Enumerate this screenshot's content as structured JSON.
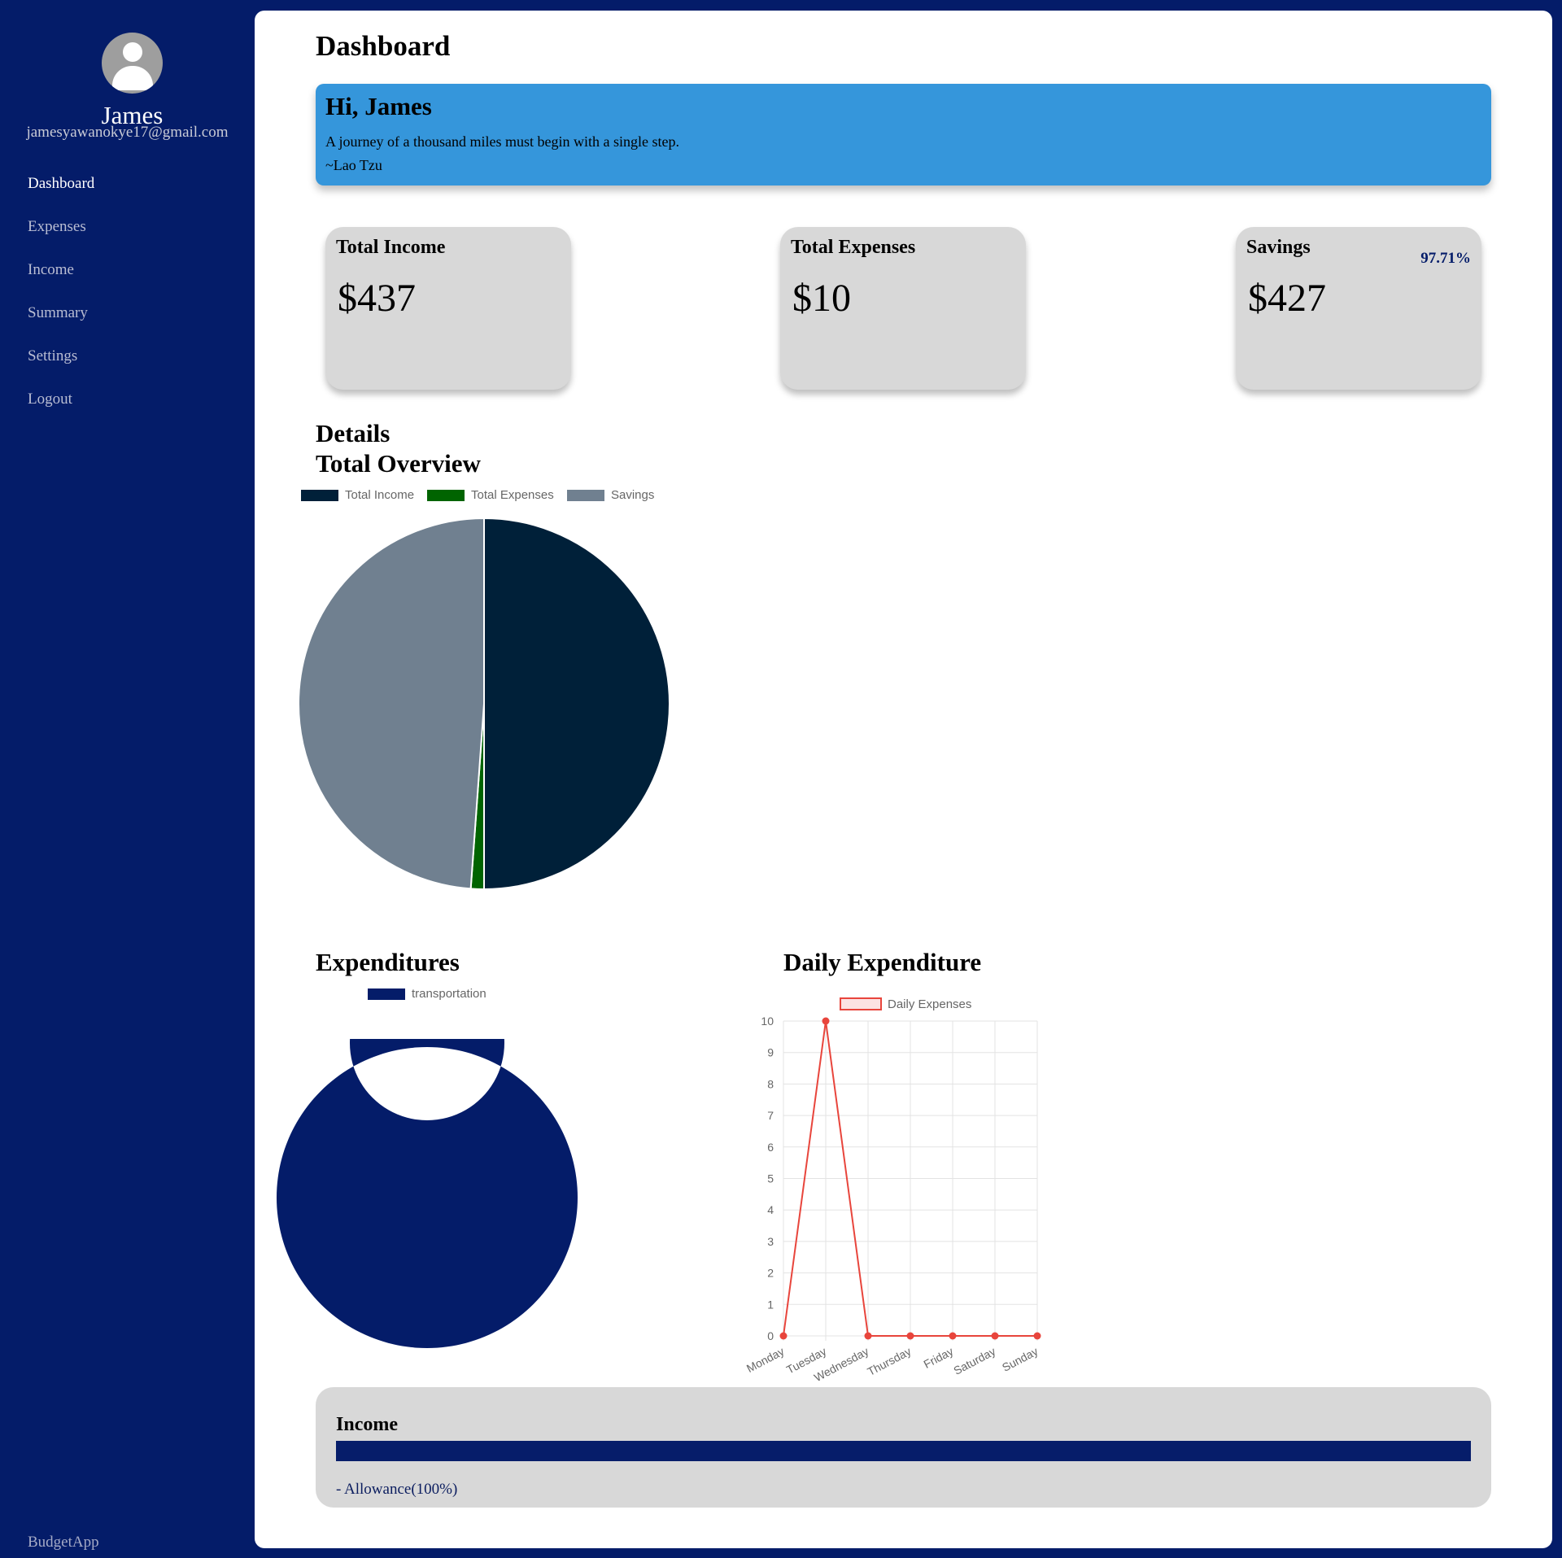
{
  "sidebar": {
    "user_name": "James",
    "user_email": "jamesyawanokye17@gmail.com",
    "nav": [
      "Dashboard",
      "Expenses",
      "Income",
      "Summary",
      "Settings",
      "Logout"
    ],
    "active_nav": "Dashboard",
    "brand": "BudgetApp"
  },
  "header": {
    "title": "Dashboard"
  },
  "banner": {
    "greeting": "Hi, James",
    "quote": "A journey of a thousand miles must begin with a single step.",
    "author": "~Lao Tzu",
    "color": "#3596db"
  },
  "stats": [
    {
      "label": "Total Income",
      "value": "$437"
    },
    {
      "label": "Total Expenses",
      "value": "$10"
    },
    {
      "label": "Savings",
      "value": "$427",
      "percent": "97.71%"
    }
  ],
  "details": {
    "title": "Details"
  },
  "overview": {
    "title": "Total Overview"
  },
  "expenditures": {
    "title": "Expenditures"
  },
  "daily": {
    "title": "Daily Expenditure"
  },
  "income_section": {
    "title": "Income",
    "sources": [
      "- Allowance(100%)"
    ]
  },
  "colors": {
    "sidebar_bg": "#041c69",
    "accent": "#041c69",
    "income": "#002039",
    "expenses": "#006400",
    "savings": "#708090",
    "daily_line": "#e8453c"
  },
  "chart_data": [
    {
      "type": "pie",
      "categories": [
        "Total Income",
        "Total Expenses",
        "Savings"
      ],
      "values": [
        437,
        10,
        427
      ],
      "colors": [
        "#002039",
        "#006400",
        "#708090"
      ],
      "legend": "top"
    },
    {
      "type": "pie",
      "variant": "doughnut",
      "categories": [
        "transportation"
      ],
      "values": [
        10
      ],
      "colors": [
        "#041c69"
      ],
      "legend": "top"
    },
    {
      "type": "line",
      "x": [
        "Monday",
        "Tuesday",
        "Wednesday",
        "Thursday",
        "Friday",
        "Saturday",
        "Sunday"
      ],
      "series": [
        {
          "name": "Daily Expenses",
          "values": [
            0,
            10,
            0,
            0,
            0,
            0,
            0
          ]
        }
      ],
      "ylim": [
        0,
        10
      ],
      "yticks": [
        "0",
        "1",
        "2",
        "3",
        "4",
        "5",
        "6",
        "7",
        "8",
        "9",
        "10"
      ],
      "grid": true,
      "legend": "top"
    }
  ]
}
